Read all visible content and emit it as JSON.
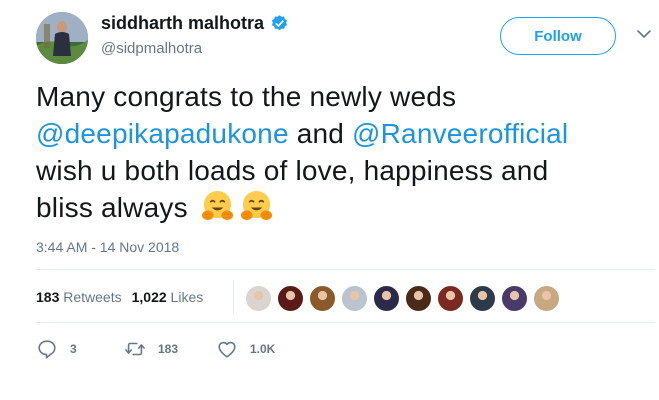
{
  "user": {
    "display_name": "siddharth malhotra",
    "handle": "@sidpmalhotra"
  },
  "follow_label": "Follow",
  "tweet": {
    "line1": "Many congrats to the newly weds",
    "mention1": "@deepikapadukone",
    "and": " and ",
    "mention2": "@Ranveerofficial",
    "line3": "wish u both loads of love, happiness and",
    "line4": "bliss always"
  },
  "timestamp": "3:44 AM - 14 Nov 2018",
  "stats": {
    "retweets_count": "183",
    "retweets_label": "Retweets",
    "likes_count": "1,022",
    "likes_label": "Likes"
  },
  "likers": [
    {
      "color": "#d9d4cf"
    },
    {
      "color": "#5a1a16"
    },
    {
      "color": "#8a5a2a"
    },
    {
      "color": "#b9c4cf"
    },
    {
      "color": "#2b2a4a"
    },
    {
      "color": "#4a2a18"
    },
    {
      "color": "#7a2a20"
    },
    {
      "color": "#2c3a4a"
    },
    {
      "color": "#4a3a6a"
    },
    {
      "color": "#c8a880"
    }
  ],
  "actions": {
    "reply_count": "3",
    "retweet_count": "183",
    "like_count": "1.0K"
  },
  "colors": {
    "accent": "#1da1f2",
    "mention": "#1b95e0",
    "secondary_text": "#657786",
    "verified": "#1da1f2"
  },
  "icons": {
    "verified": "verified-badge-icon",
    "caret": "chevron-down-icon",
    "reply": "reply-bubble-icon",
    "retweet": "retweet-icon",
    "like": "heart-icon",
    "emoji": "hugging-face-emoji"
  }
}
